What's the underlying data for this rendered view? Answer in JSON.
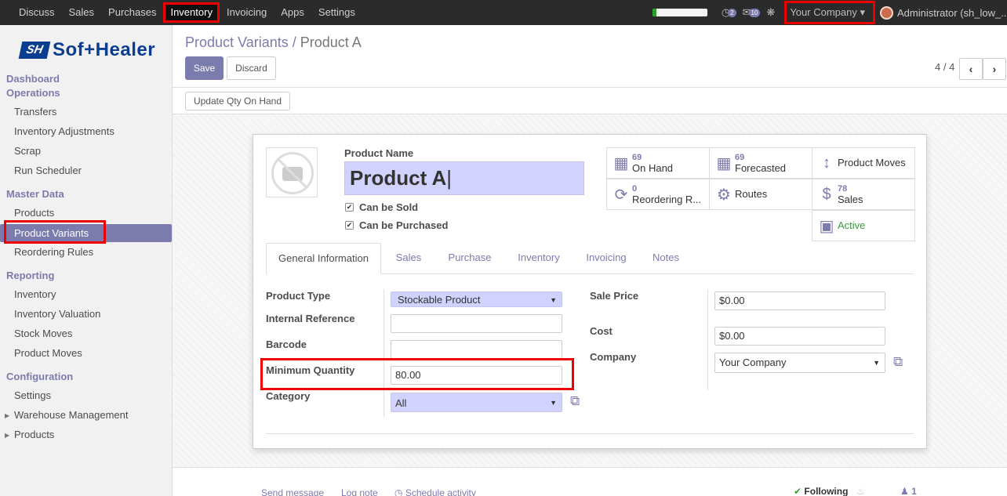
{
  "topbar": {
    "menu": [
      "Discuss",
      "Sales",
      "Purchases",
      "Inventory",
      "Invoicing",
      "Apps",
      "Settings"
    ],
    "active_menu": "Inventory",
    "progress": 0.08,
    "activity_count": "2",
    "message_count": "10",
    "company": "Your Company",
    "user": "Administrator (sh_low_..."
  },
  "sidebar": {
    "logo_mark": "SH",
    "logo_text": "Sof+Healer",
    "sections": {
      "dashboard": "Dashboard",
      "operations": "Operations",
      "master_data": "Master Data",
      "reporting": "Reporting",
      "configuration": "Configuration"
    },
    "operations_items": [
      "Transfers",
      "Inventory Adjustments",
      "Scrap",
      "Run Scheduler"
    ],
    "master_items": [
      "Products",
      "Product Variants",
      "Reordering Rules"
    ],
    "reporting_items": [
      "Inventory",
      "Inventory Valuation",
      "Stock Moves",
      "Product Moves"
    ],
    "config_items": [
      "Settings",
      "Warehouse Management",
      "Products"
    ]
  },
  "control": {
    "breadcrumb_parent": "Product Variants",
    "breadcrumb_sep": " / ",
    "breadcrumb_current": "Product A",
    "save": "Save",
    "discard": "Discard",
    "pager": "4 / 4",
    "prev": "‹",
    "next": "›",
    "update_qty": "Update Qty On Hand"
  },
  "form": {
    "product_name_label": "Product Name",
    "product_name": "Product A",
    "can_be_sold": "Can be Sold",
    "can_be_purchased": "Can be Purchased",
    "smart": {
      "on_hand_value": "69",
      "on_hand_label": "On Hand",
      "forecasted_value": "69",
      "forecasted_label": "Forecasted",
      "product_moves_label": "Product Moves",
      "reordering_value": "0",
      "reordering_label": "Reordering R...",
      "routes_label": "Routes",
      "sales_value": "78",
      "sales_label": "Sales",
      "active_label": "Active"
    },
    "tabs": [
      "General Information",
      "Sales",
      "Purchase",
      "Inventory",
      "Invoicing",
      "Notes"
    ],
    "fields": {
      "product_type_label": "Product Type",
      "product_type": "Stockable Product",
      "internal_ref_label": "Internal Reference",
      "internal_ref": "",
      "barcode_label": "Barcode",
      "barcode": "",
      "min_qty_label": "Minimum Quantity",
      "min_qty": "80.00",
      "category_label": "Category",
      "category": "All",
      "sale_price_label": "Sale Price",
      "sale_price": "$0.00",
      "cost_label": "Cost",
      "cost": "$0.00",
      "company_label": "Company",
      "company": "Your Company"
    }
  },
  "chatter": {
    "send_message": "Send message",
    "log_note": "Log note",
    "schedule_activity": "Schedule activity",
    "following": "Following",
    "followers": "1"
  },
  "colors": {
    "brand": "#7c7bad",
    "highlight": "#e00000",
    "field_required": "#d2d2ff"
  }
}
